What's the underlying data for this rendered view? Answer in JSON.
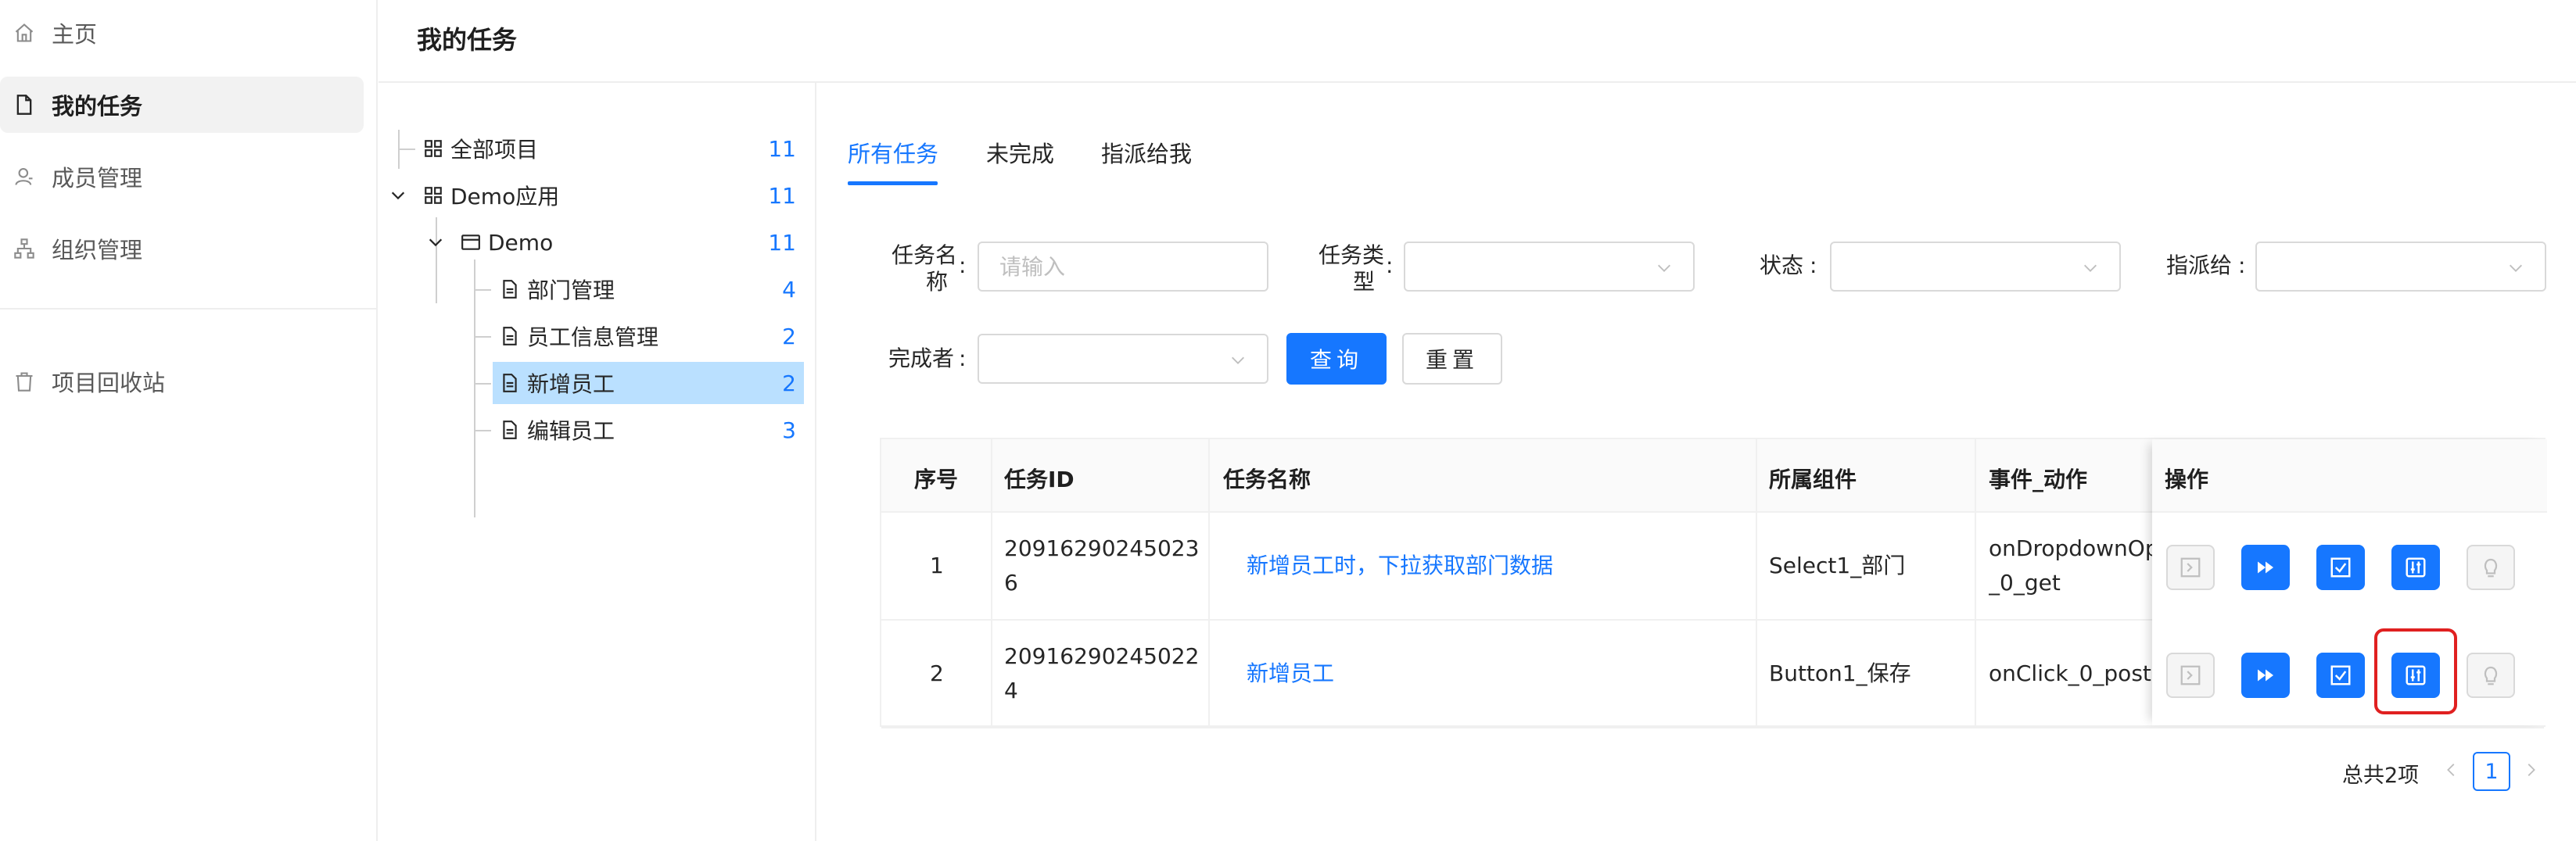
{
  "sidebar": {
    "items": [
      {
        "label": "主页",
        "icon": "home-icon"
      },
      {
        "label": "我的任务",
        "icon": "file-icon",
        "active": true
      },
      {
        "label": "成员管理",
        "icon": "user-icon"
      },
      {
        "label": "组织管理",
        "icon": "org-icon"
      },
      {
        "label": "项目回收站",
        "icon": "trash-icon"
      }
    ]
  },
  "header": {
    "title": "我的任务"
  },
  "tree": {
    "nodes": [
      {
        "label": "全部项目",
        "count": "11",
        "icon": "appstore-icon"
      },
      {
        "label": "Demo应用",
        "count": "11",
        "icon": "appstore-icon"
      },
      {
        "label": "Demo",
        "count": "11",
        "icon": "window-icon"
      },
      {
        "label": "部门管理",
        "count": "4",
        "icon": "file-icon"
      },
      {
        "label": "员工信息管理",
        "count": "2",
        "icon": "file-icon"
      },
      {
        "label": "新增员工",
        "count": "2",
        "icon": "file-icon",
        "selected": true
      },
      {
        "label": "编辑员工",
        "count": "3",
        "icon": "file-icon"
      }
    ]
  },
  "tabs": [
    "所有任务",
    "未完成",
    "指派给我"
  ],
  "filters": {
    "task_name_label_1": "任务名",
    "task_name_label_2": "称",
    "task_name_placeholder": "请输入",
    "task_type_label_1": "任务类",
    "task_type_label_2": "型",
    "status_label": "状态",
    "assignee_label": "指派给",
    "completer_label": "完成者",
    "colon": ":",
    "query_button": "查询",
    "reset_button": "重置"
  },
  "table": {
    "columns": [
      "序号",
      "任务ID",
      "任务名称",
      "所属组件",
      "事件_动作",
      "操作"
    ],
    "rows": [
      {
        "index": "1",
        "id_line1": "20916290245023",
        "id_line2": "6",
        "name": "新增员工时，下拉获取部门数据",
        "component": "Select1_部门",
        "event_line1": "onDropdownOpe",
        "event_line2": "_0_get"
      },
      {
        "index": "2",
        "id_line1": "20916290245022",
        "id_line2": "4",
        "name": "新增员工",
        "component": "Button1_保存",
        "event_line1": "onClick_0_post",
        "event_line2": ""
      }
    ],
    "actions": [
      "run-disabled-icon",
      "fast-forward-icon",
      "check-square-icon",
      "settings-sliders-icon",
      "bulb-icon"
    ]
  },
  "pagination": {
    "total": "总共2项",
    "current_page": "1"
  },
  "colors": {
    "primary": "#1677ff",
    "selected_bg": "#bae0ff",
    "highlight": "#e02020"
  }
}
